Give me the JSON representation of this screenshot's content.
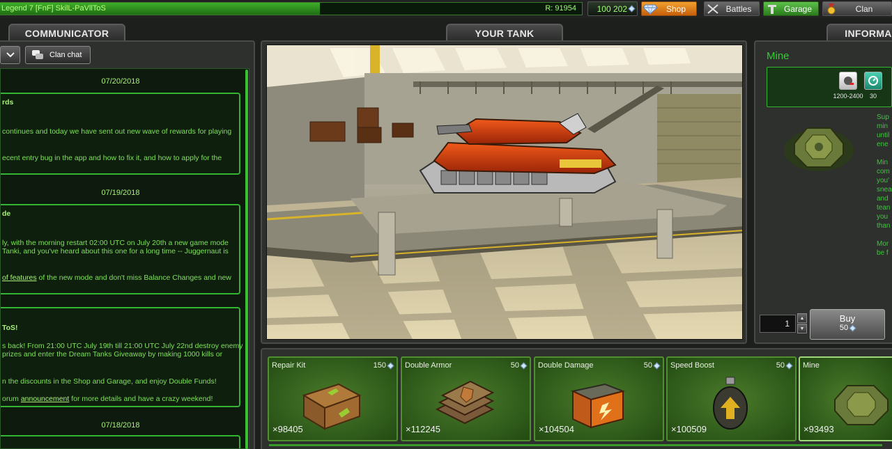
{
  "topbar": {
    "player_name": "Legend 7 [FnF] SkilL-PaVllToS",
    "rank_score": "R: 91954",
    "rank_progress": 0.55,
    "crystals": "100 202",
    "shop_label": "Shop",
    "battles_label": "Battles",
    "garage_label": "Garage",
    "clan_label": "Clan"
  },
  "titles": {
    "communicator": "COMMUNICATOR",
    "your_tank": "YOUR TANK",
    "information": "INFORMA"
  },
  "communicator": {
    "clan_chat_label": "Clan chat",
    "news": [
      {
        "date": "07/20/2018",
        "lines": [
          {
            "text": "rds",
            "type": "title"
          },
          {
            "text": "continues and today we have sent out new wave of rewards for playing",
            "type": "body"
          },
          {
            "text": "ecent entry bug in the app and how to fix it, and how to apply for the",
            "type": "body"
          }
        ]
      },
      {
        "date": "07/19/2018",
        "lines": [
          {
            "text": "de",
            "type": "title"
          },
          {
            "text": "ly, with the morning restart 02:00 UTC on July 20th a new game mode",
            "type": "body"
          },
          {
            "text": "Tanki, and you've heard about this one for a long time -- Juggernaut is",
            "type": "body"
          },
          {
            "text_link": " of features",
            "text_after": " of the new mode and don't miss Balance Changes and new",
            "type": "link"
          }
        ]
      },
      {
        "date": "",
        "lines": [
          {
            "text": "ToS!",
            "type": "title"
          },
          {
            "text": "s back! From 21:00 UTC July 19th till 21:00 UTC July 22nd destroy enemy",
            "type": "body"
          },
          {
            "text": " prizes and enter the Dream Tanks Giveaway by making 1000 kills or",
            "type": "body"
          },
          {
            "text": "n the discounts in the Shop and Garage, and enjoy Double Funds!",
            "type": "body"
          },
          {
            "text_before": "orum  ",
            "text_link": "announcement",
            "text_after": " for more details and have a crazy weekend!",
            "type": "link2"
          }
        ]
      },
      {
        "date": "07/18/2018",
        "lines": []
      }
    ]
  },
  "info": {
    "name": "Mine",
    "stats": [
      {
        "icon": "damage-icon",
        "value": "1200-2400"
      },
      {
        "icon": "reload-icon",
        "value": "30"
      }
    ],
    "description": [
      "Sup",
      "min",
      "until",
      "ene",
      "",
      "Min",
      "com",
      "you'",
      "snea",
      "and",
      "tean",
      "you",
      "than",
      "",
      "Mor",
      "be f"
    ],
    "quantity": "1",
    "buy_label": "Buy",
    "buy_price": "50"
  },
  "items": [
    {
      "name": "Repair Kit",
      "price": "150",
      "count": "×98405",
      "icon": "repair-kit-icon"
    },
    {
      "name": "Double Armor",
      "price": "50",
      "count": "×112245",
      "icon": "double-armor-icon"
    },
    {
      "name": "Double Damage",
      "price": "50",
      "count": "×104504",
      "icon": "double-damage-icon"
    },
    {
      "name": "Speed Boost",
      "price": "50",
      "count": "×100509",
      "icon": "speed-boost-icon"
    },
    {
      "name": "Mine",
      "price": "",
      "count": "×93493",
      "icon": "mine-icon"
    }
  ],
  "colors": {
    "accent_green": "#33b533",
    "text_green": "#7fe05a",
    "shop_orange": "#e88a20"
  }
}
